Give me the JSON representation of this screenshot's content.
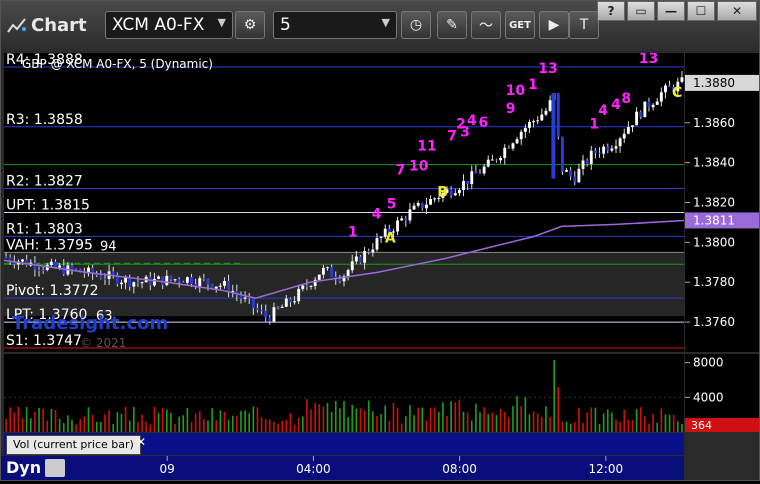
{
  "toolbar": {
    "app_title": "Chart",
    "symbol": "XCM A0-FX",
    "interval": "5",
    "get_label": "GET"
  },
  "window_controls": {
    "help": "?",
    "restore": "▭",
    "minimize": "—",
    "maximize": "☐",
    "close": "✕"
  },
  "chart_data": {
    "type": "candlestick",
    "title": "GBP @ XCM A0-FX, 5 (Dynamic)",
    "watermark": "Tradesight.com",
    "copyright": "© 2021",
    "ylim": [
      1.3745,
      1.3895
    ],
    "y_ticks": [
      "1.3880",
      "1.3860",
      "1.3840",
      "1.3820",
      "1.3800",
      "1.3780",
      "1.3760"
    ],
    "last_price": "1.3880",
    "ma_value": "1.3811",
    "x_ticks": [
      "09",
      "04:00",
      "08:00",
      "12:00"
    ],
    "levels": [
      {
        "label": "R4: 1.3888",
        "value": 1.3888,
        "color": "#2a3bd8"
      },
      {
        "label": "R3: 1.3858",
        "value": 1.3858,
        "color": "#2a3bd8"
      },
      {
        "label": "",
        "value": 1.3839,
        "color": "#1a9a1a"
      },
      {
        "label": "R2: 1.3827",
        "value": 1.3827,
        "color": "#2a3bd8"
      },
      {
        "label": "UPT: 1.3815",
        "value": 1.3815,
        "color": "#d8d8e8"
      },
      {
        "label": "R1: 1.3803",
        "value": 1.3803,
        "color": "#2a3bd8"
      },
      {
        "label": "VAH: 1.3795",
        "value": 1.3795,
        "color": "#888888"
      },
      {
        "label": "",
        "value": 1.3789,
        "color": "#1a9a1a"
      },
      {
        "label": "Pivot: 1.3772",
        "value": 1.3772,
        "color": "#2a3bd8"
      },
      {
        "label": "LPT: 1.3760",
        "value": 1.376,
        "color": "#d8d8e8"
      },
      {
        "label": "S1: 1.3747",
        "value": 1.3747,
        "color": "#e01010"
      }
    ],
    "vah_extra": "94",
    "lpt_extra": "63",
    "annotations": [
      {
        "text": "1",
        "x": 0.513,
        "y": 1.3803,
        "color": "#ff22ff"
      },
      {
        "text": "4",
        "x": 0.548,
        "y": 1.3812,
        "color": "#ff22ff"
      },
      {
        "text": "5",
        "x": 0.57,
        "y": 1.3817,
        "color": "#ff22ff"
      },
      {
        "text": "7",
        "x": 0.583,
        "y": 1.3834,
        "color": "#ff22ff"
      },
      {
        "text": "10",
        "x": 0.61,
        "y": 1.3836,
        "color": "#ff22ff"
      },
      {
        "text": "11",
        "x": 0.622,
        "y": 1.3846,
        "color": "#ff22ff"
      },
      {
        "text": "2",
        "x": 0.672,
        "y": 1.3857,
        "color": "#ff22ff"
      },
      {
        "text": "4",
        "x": 0.688,
        "y": 1.3859,
        "color": "#ff22ff"
      },
      {
        "text": "6",
        "x": 0.705,
        "y": 1.3858,
        "color": "#ff22ff"
      },
      {
        "text": "7",
        "x": 0.659,
        "y": 1.3851,
        "color": "#ff22ff"
      },
      {
        "text": "3",
        "x": 0.678,
        "y": 1.3853,
        "color": "#ff22ff"
      },
      {
        "text": "10",
        "x": 0.752,
        "y": 1.3874,
        "color": "#ff22ff"
      },
      {
        "text": "9",
        "x": 0.745,
        "y": 1.3865,
        "color": "#ff22ff"
      },
      {
        "text": "1",
        "x": 0.778,
        "y": 1.3877,
        "color": "#ff22ff"
      },
      {
        "text": "13",
        "x": 0.8,
        "y": 1.3885,
        "color": "#ff22ff"
      },
      {
        "text": "1",
        "x": 0.868,
        "y": 1.3857,
        "color": "#ff22ff"
      },
      {
        "text": "4",
        "x": 0.881,
        "y": 1.3864,
        "color": "#ff22ff"
      },
      {
        "text": "4",
        "x": 0.9,
        "y": 1.3867,
        "color": "#ff22ff"
      },
      {
        "text": "8",
        "x": 0.915,
        "y": 1.387,
        "color": "#ff22ff"
      },
      {
        "text": "13",
        "x": 0.948,
        "y": 1.389,
        "color": "#ff22ff"
      },
      {
        "text": "A",
        "x": 0.568,
        "y": 1.38,
        "color": "#f0f020"
      },
      {
        "text": "B",
        "x": 0.645,
        "y": 1.3823,
        "color": "#f0f020"
      },
      {
        "text": "C",
        "x": 0.99,
        "y": 1.3873,
        "color": "#f0f020"
      }
    ],
    "volume_ylim": [
      0,
      9000
    ],
    "volume_ticks": [
      "8000",
      "4000"
    ],
    "volume_last": "364",
    "volume_label": "Vol (current price bar)"
  },
  "status": {
    "dyn_label": "Dyn"
  }
}
